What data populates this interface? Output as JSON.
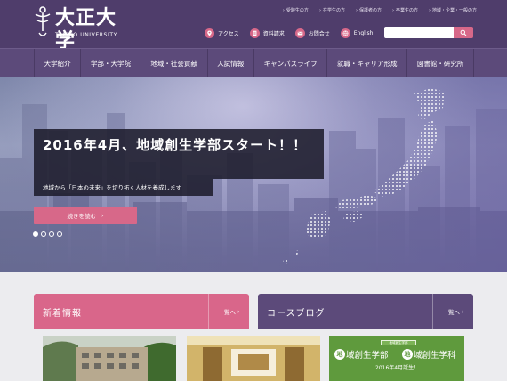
{
  "header": {
    "logo_title": "大正大学",
    "logo_sub": "TAISHO UNIVERSITY",
    "top_links": [
      "受験生の方",
      "在学生の方",
      "保護者の方",
      "卒業生の方",
      "地域・企業・一般の方"
    ],
    "utility": [
      {
        "label": "アクセス",
        "icon": "map-pin-icon"
      },
      {
        "label": "資料請求",
        "icon": "document-icon"
      },
      {
        "label": "お問合せ",
        "icon": "mail-icon"
      },
      {
        "label": "English",
        "icon": "globe-icon"
      }
    ],
    "search_placeholder": ""
  },
  "nav": {
    "items": [
      "大学紹介",
      "学部・大学院",
      "地域・社会貢献",
      "入試情報",
      "キャンパスライフ",
      "就職・キャリア形成",
      "図書館・研究所"
    ]
  },
  "hero": {
    "headline": "2016年4月、地域創生学部スタート！！",
    "subline": "地域から「日本の未来」を切り拓く人材を養成します",
    "more_label": "続きを読む",
    "slides_total": 4,
    "slide_active": 1
  },
  "panels": {
    "news": {
      "title": "新着情報",
      "more": "一覧へ"
    },
    "blog": {
      "title": "コースブログ",
      "more": "一覧へ"
    }
  },
  "thumbs": {
    "t3_badge": "地域創生学部",
    "t3_line1_circle": "地",
    "t3_line1_text": "域創生学部",
    "t3_line2_circle": "地",
    "t3_line2_text": "域創生学科",
    "t3_date": "2016年4月誕生！"
  },
  "colors": {
    "header_bg": "#4f3d6b",
    "nav_bg": "#5c4a7a",
    "accent_pink": "#d76889",
    "news_head": "#d9668a",
    "blog_head": "#5c4a7a",
    "content_bg": "#ececef"
  }
}
